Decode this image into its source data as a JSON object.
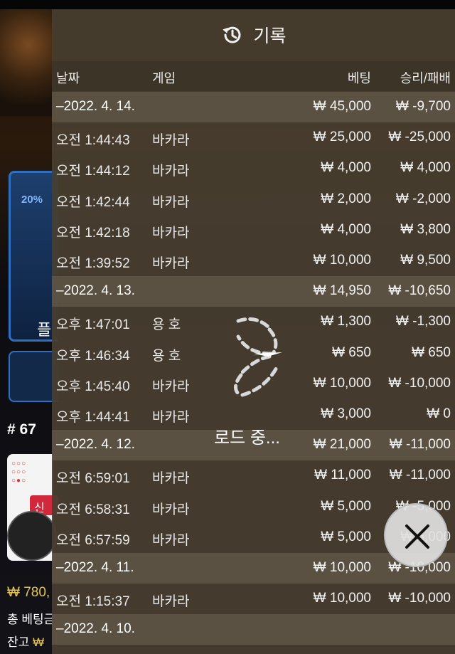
{
  "background": {
    "progress_badge": "20%",
    "play_label": "플",
    "round_label": "# 67",
    "new_badge": "신",
    "balance_partial": "₩ 780,",
    "total_bet_label": "총 베팅금",
    "balance_label": "잔고",
    "balance_won": "₩"
  },
  "panel": {
    "title": "기록",
    "headers": {
      "date": "날짜",
      "game": "게임",
      "bet": "베팅",
      "result": "승리/패배"
    },
    "rows": [
      {
        "type": "date",
        "time": "–2022. 4. 14.",
        "game": "",
        "bet": "₩ 45,000",
        "result": "₩ -9,700"
      },
      {
        "type": "item",
        "time": "오전 1:44:43",
        "game": "바카라",
        "bet": "₩ 25,000",
        "result": "₩ -25,000"
      },
      {
        "type": "item",
        "time": "오전 1:44:12",
        "game": "바카라",
        "bet": "₩ 4,000",
        "result": "₩ 4,000"
      },
      {
        "type": "item",
        "time": "오전 1:42:44",
        "game": "바카라",
        "bet": "₩ 2,000",
        "result": "₩ -2,000"
      },
      {
        "type": "item",
        "time": "오전 1:42:18",
        "game": "바카라",
        "bet": "₩ 4,000",
        "result": "₩ 3,800"
      },
      {
        "type": "item",
        "time": "오전 1:39:52",
        "game": "바카라",
        "bet": "₩ 10,000",
        "result": "₩ 9,500"
      },
      {
        "type": "date",
        "time": "–2022. 4. 13.",
        "game": "",
        "bet": "₩ 14,950",
        "result": "₩ -10,650"
      },
      {
        "type": "item",
        "time": "오후 1:47:01",
        "game": "용 호",
        "bet": "₩ 1,300",
        "result": "₩ -1,300"
      },
      {
        "type": "item",
        "time": "오후 1:46:34",
        "game": "용 호",
        "bet": "₩ 650",
        "result": "₩ 650"
      },
      {
        "type": "item",
        "time": "오후 1:45:40",
        "game": "바카라",
        "bet": "₩ 10,000",
        "result": "₩ -10,000"
      },
      {
        "type": "item",
        "time": "오후 1:44:41",
        "game": "바카라",
        "bet": "₩ 3,000",
        "result": "₩ 0"
      },
      {
        "type": "date",
        "time": "–2022. 4. 12.",
        "game": "",
        "bet": "₩ 21,000",
        "result": "₩ -11,000"
      },
      {
        "type": "item",
        "time": "오전 6:59:01",
        "game": "바카라",
        "bet": "₩ 11,000",
        "result": "₩ -11,000"
      },
      {
        "type": "item",
        "time": "오전 6:58:31",
        "game": "바카라",
        "bet": "₩ 5,000",
        "result": "₩ -5,000"
      },
      {
        "type": "item",
        "time": "오전 6:57:59",
        "game": "바카라",
        "bet": "₩ 5,000",
        "result": "₩ 5,000"
      },
      {
        "type": "date",
        "time": "–2022. 4. 11.",
        "game": "",
        "bet": "₩ 10,000",
        "result": "₩ -10,000"
      },
      {
        "type": "item",
        "time": "오전 1:15:37",
        "game": "바카라",
        "bet": "₩ 10,000",
        "result": "₩ -10,000"
      },
      {
        "type": "date",
        "time": "–2022. 4. 10.",
        "game": "",
        "bet": "",
        "result": ""
      }
    ],
    "loading_text": "로드 중...",
    "icons": {
      "header": "history-icon",
      "loader": "loading-spinner-icon",
      "close": "close-icon"
    }
  }
}
